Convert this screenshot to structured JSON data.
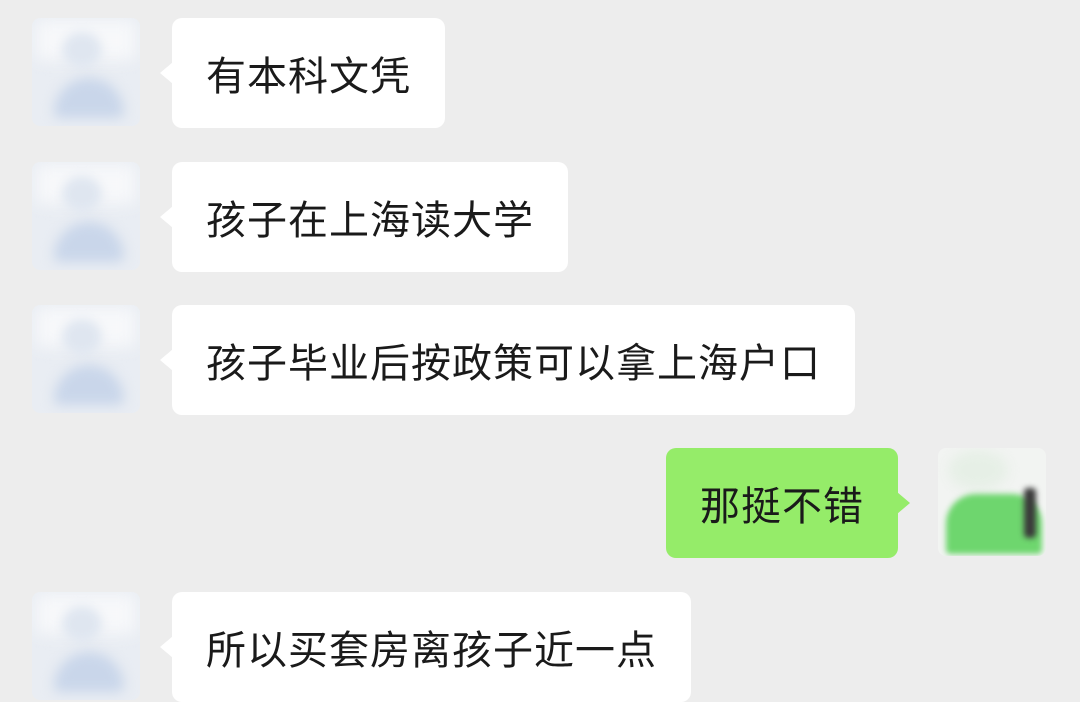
{
  "colors": {
    "background": "#ededed",
    "incoming_bubble": "#ffffff",
    "outgoing_bubble": "#95ec69",
    "text": "#1a1a1a"
  },
  "messages": [
    {
      "direction": "incoming",
      "text": "有本科文凭",
      "avatar_icon": "contact-avatar"
    },
    {
      "direction": "incoming",
      "text": "孩子在上海读大学",
      "avatar_icon": "contact-avatar"
    },
    {
      "direction": "incoming",
      "text": "孩子毕业后按政策可以拿上海户口",
      "avatar_icon": "contact-avatar"
    },
    {
      "direction": "outgoing",
      "text": "那挺不错",
      "avatar_icon": "self-avatar"
    },
    {
      "direction": "incoming",
      "text": "所以买套房离孩子近一点",
      "avatar_icon": "contact-avatar"
    }
  ]
}
